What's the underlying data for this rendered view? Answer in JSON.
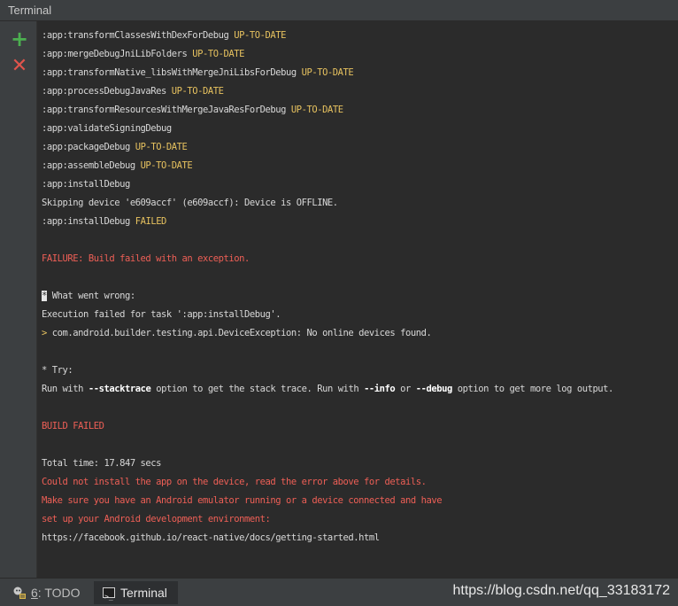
{
  "window": {
    "title": "Terminal"
  },
  "toolstrip": {
    "add_icon": "plus-icon",
    "close_icon": "close-icon"
  },
  "terminal": {
    "lines": [
      {
        "parts": [
          {
            "text": ":app:transformClassesWithDexForDebug ",
            "style": "normal"
          },
          {
            "text": "UP-TO-DATE",
            "style": "ok"
          }
        ]
      },
      {
        "parts": [
          {
            "text": ":app:mergeDebugJniLibFolders ",
            "style": "normal"
          },
          {
            "text": "UP-TO-DATE",
            "style": "ok"
          }
        ]
      },
      {
        "parts": [
          {
            "text": ":app:transformNative_libsWithMergeJniLibsForDebug ",
            "style": "normal"
          },
          {
            "text": "UP-TO-DATE",
            "style": "ok"
          }
        ]
      },
      {
        "parts": [
          {
            "text": ":app:processDebugJavaRes ",
            "style": "normal"
          },
          {
            "text": "UP-TO-DATE",
            "style": "ok"
          }
        ]
      },
      {
        "parts": [
          {
            "text": ":app:transformResourcesWithMergeJavaResForDebug ",
            "style": "normal"
          },
          {
            "text": "UP-TO-DATE",
            "style": "ok"
          }
        ]
      },
      {
        "parts": [
          {
            "text": ":app:validateSigningDebug",
            "style": "normal"
          }
        ]
      },
      {
        "parts": [
          {
            "text": ":app:packageDebug ",
            "style": "normal"
          },
          {
            "text": "UP-TO-DATE",
            "style": "ok"
          }
        ]
      },
      {
        "parts": [
          {
            "text": ":app:assembleDebug ",
            "style": "normal"
          },
          {
            "text": "UP-TO-DATE",
            "style": "ok"
          }
        ]
      },
      {
        "parts": [
          {
            "text": ":app:installDebug",
            "style": "normal"
          }
        ]
      },
      {
        "parts": [
          {
            "text": "Skipping device 'e609accf' (e609accf): Device is OFFLINE.",
            "style": "normal"
          }
        ]
      },
      {
        "parts": [
          {
            "text": ":app:installDebug ",
            "style": "normal"
          },
          {
            "text": "FAILED",
            "style": "ok"
          }
        ]
      },
      {
        "parts": []
      },
      {
        "parts": [
          {
            "text": "FAILURE: Build failed with an exception.",
            "style": "red"
          }
        ]
      },
      {
        "parts": []
      },
      {
        "parts": [
          {
            "text": "*",
            "style": "cursor"
          },
          {
            "text": " What went wrong:",
            "style": "normal"
          }
        ]
      },
      {
        "parts": [
          {
            "text": "Execution failed for task ':app:installDebug'.",
            "style": "normal"
          }
        ]
      },
      {
        "parts": [
          {
            "text": "> ",
            "style": "gt"
          },
          {
            "text": "com.android.builder.testing.api.DeviceException: No online devices found.",
            "style": "normal"
          }
        ]
      },
      {
        "parts": []
      },
      {
        "parts": [
          {
            "text": "* Try:",
            "style": "normal"
          }
        ]
      },
      {
        "parts": [
          {
            "text": "Run with ",
            "style": "normal"
          },
          {
            "text": "--stacktrace",
            "style": "bold"
          },
          {
            "text": " option to get the stack trace. Run with ",
            "style": "normal"
          },
          {
            "text": "--info",
            "style": "bold"
          },
          {
            "text": " or ",
            "style": "normal"
          },
          {
            "text": "--debug",
            "style": "bold"
          },
          {
            "text": " option to get more log output.",
            "style": "normal"
          }
        ]
      },
      {
        "parts": []
      },
      {
        "parts": [
          {
            "text": "BUILD FAILED",
            "style": "red"
          }
        ]
      },
      {
        "parts": []
      },
      {
        "parts": [
          {
            "text": "Total time: 17.847 secs",
            "style": "normal"
          }
        ]
      },
      {
        "parts": [
          {
            "text": "Could not install the app on the device, read the error above for details.",
            "style": "red"
          }
        ]
      },
      {
        "parts": [
          {
            "text": "Make sure you have an Android emulator running or a device connected and have",
            "style": "red"
          }
        ]
      },
      {
        "parts": [
          {
            "text": "set up your Android development environment:",
            "style": "red"
          }
        ]
      },
      {
        "parts": [
          {
            "text": "https://facebook.github.io/react-native/docs/getting-started.html",
            "style": "normal"
          }
        ]
      }
    ]
  },
  "statusbar": {
    "todo_number": "6",
    "todo_label": ": TODO",
    "terminal_label": "Terminal",
    "watermark": "https://blog.csdn.net/qq_33183172"
  },
  "colors": {
    "background": "#2b2b2b",
    "panel": "#3c3f41",
    "up_to_date": "#e7c25f",
    "error": "#ee5f56",
    "add": "#4caf50",
    "close": "#e0544c"
  }
}
